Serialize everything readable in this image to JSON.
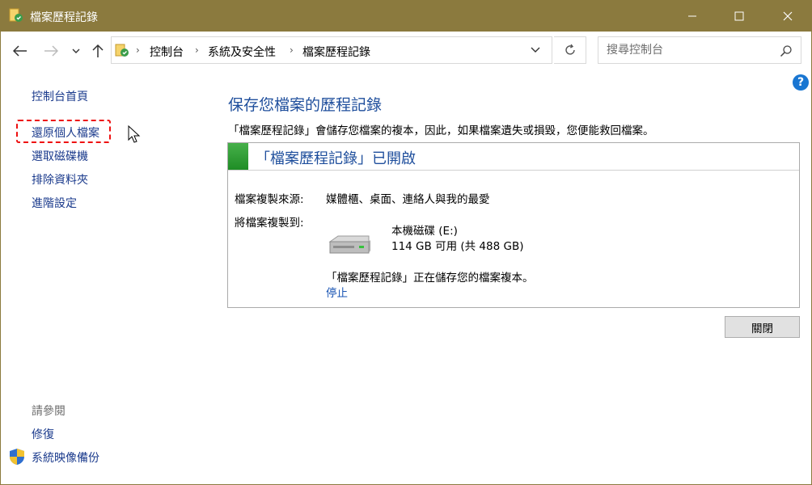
{
  "window": {
    "title": "檔案歷程記錄"
  },
  "address": {
    "crumbs": [
      "控制台",
      "系統及安全性",
      "檔案歷程記錄"
    ]
  },
  "search": {
    "placeholder": "搜尋控制台"
  },
  "left_pane": {
    "items": [
      "控制台首頁",
      "還原個人檔案",
      "選取磁碟機",
      "排除資料夾",
      "進階設定"
    ],
    "see_also_title": "請參閱",
    "see_also": [
      "修復",
      "系統映像備份"
    ]
  },
  "main": {
    "heading": "保存您檔案的歷程記錄",
    "description": "「檔案歷程記錄」會儲存您檔案的複本，因此，如果檔案遺失或損毀，您便能救回檔案。",
    "status_title": "「檔案歷程記錄」已開啟",
    "source_label": "檔案複製來源:",
    "source_value": "媒體櫃、桌面、連絡人與我的最愛",
    "dest_label": "將檔案複製到:",
    "drive_name": "本機磁碟 (E:)",
    "drive_size": "114 GB 可用 (共 488 GB)",
    "saving_text": "「檔案歷程記錄」正在儲存您的檔案複本。",
    "stop_link": "停止",
    "close_button": "關閉"
  },
  "colors": {
    "titlebar": "#8b7a3e",
    "accent": "#1e4e9c",
    "status_green": "#2ea043",
    "highlight": "#ee1111"
  }
}
